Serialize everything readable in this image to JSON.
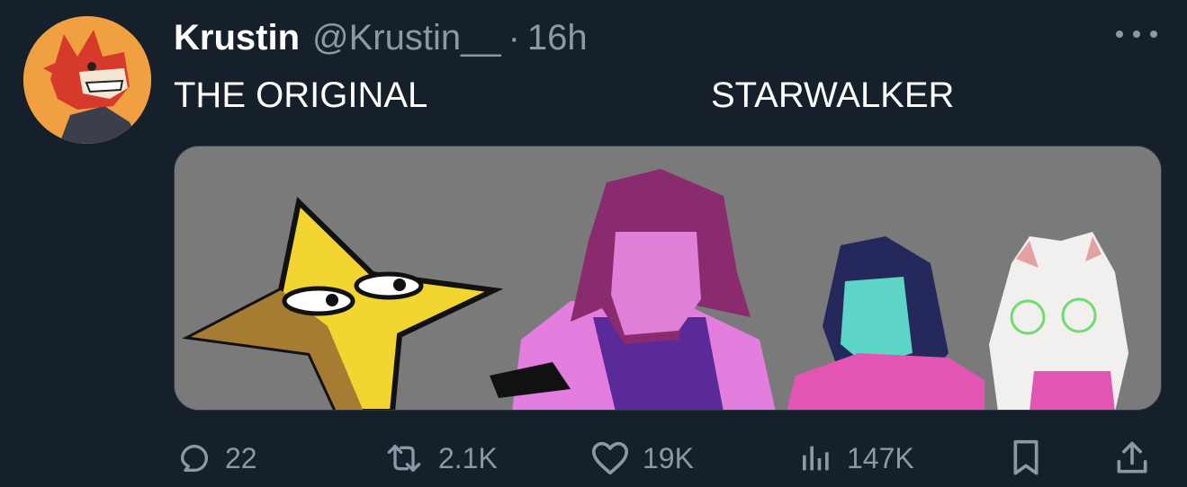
{
  "tweet": {
    "author": {
      "display_name": "Krustin",
      "handle": "@Krustin__",
      "time_separator": "·",
      "time": "16h"
    },
    "text_left": "THE ORIGINAL",
    "text_right": "STARWALKER",
    "media": {
      "subject": "illustration of a yellow star with eyes beside purple, blue-haired and white horned characters"
    },
    "actions": {
      "replies": "22",
      "retweets": "2.1K",
      "likes": "19K",
      "views": "147K"
    }
  },
  "colors": {
    "background": "#15202b",
    "secondary_text": "#8b98a5",
    "primary_text": "#ffffff",
    "media_bg": "#7a7a7a"
  },
  "icons": [
    "more-icon",
    "reply-icon",
    "retweet-icon",
    "like-icon",
    "views-icon",
    "bookmark-icon",
    "share-icon"
  ]
}
